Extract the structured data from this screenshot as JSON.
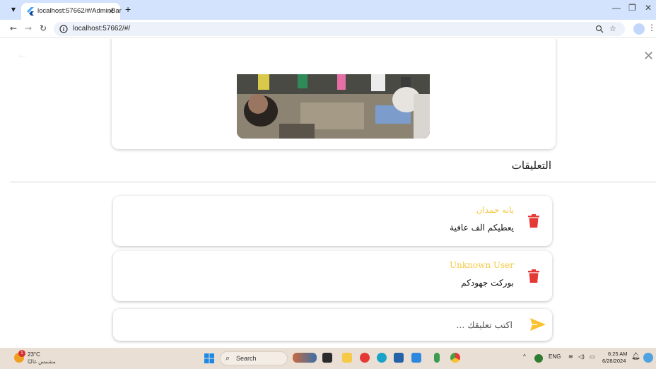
{
  "browser": {
    "tab_title": "localhost:57662/#/AdminBar",
    "tab_close": "×",
    "new_tab": "+",
    "url": "localhost:57662/#/",
    "controls": {
      "minimize": "—",
      "restore": "❐",
      "close": "✕"
    },
    "nav": {
      "back": "←",
      "forward": "→",
      "reload": "↻"
    }
  },
  "page": {
    "back_label": "←",
    "close_label": "✕",
    "comments_title": "التعليقات",
    "comments": [
      {
        "author": "يانه حمدان",
        "text": "يعطيكم الف عافية"
      },
      {
        "author": "Unknown User",
        "text": "بوركت جهودكم"
      }
    ],
    "composer": {
      "placeholder": "اكتب تعليقك ..."
    },
    "colors": {
      "author": "#f5c842",
      "delete": "#e53935",
      "send": "#fbc02d"
    }
  },
  "taskbar": {
    "weather_temp": "23°C",
    "weather_desc": "مشمس غالبًا",
    "weather_badge": "1",
    "search_label": "Search",
    "tray_lang": "ENG",
    "time": "6:25 AM",
    "date": "6/28/2024"
  }
}
